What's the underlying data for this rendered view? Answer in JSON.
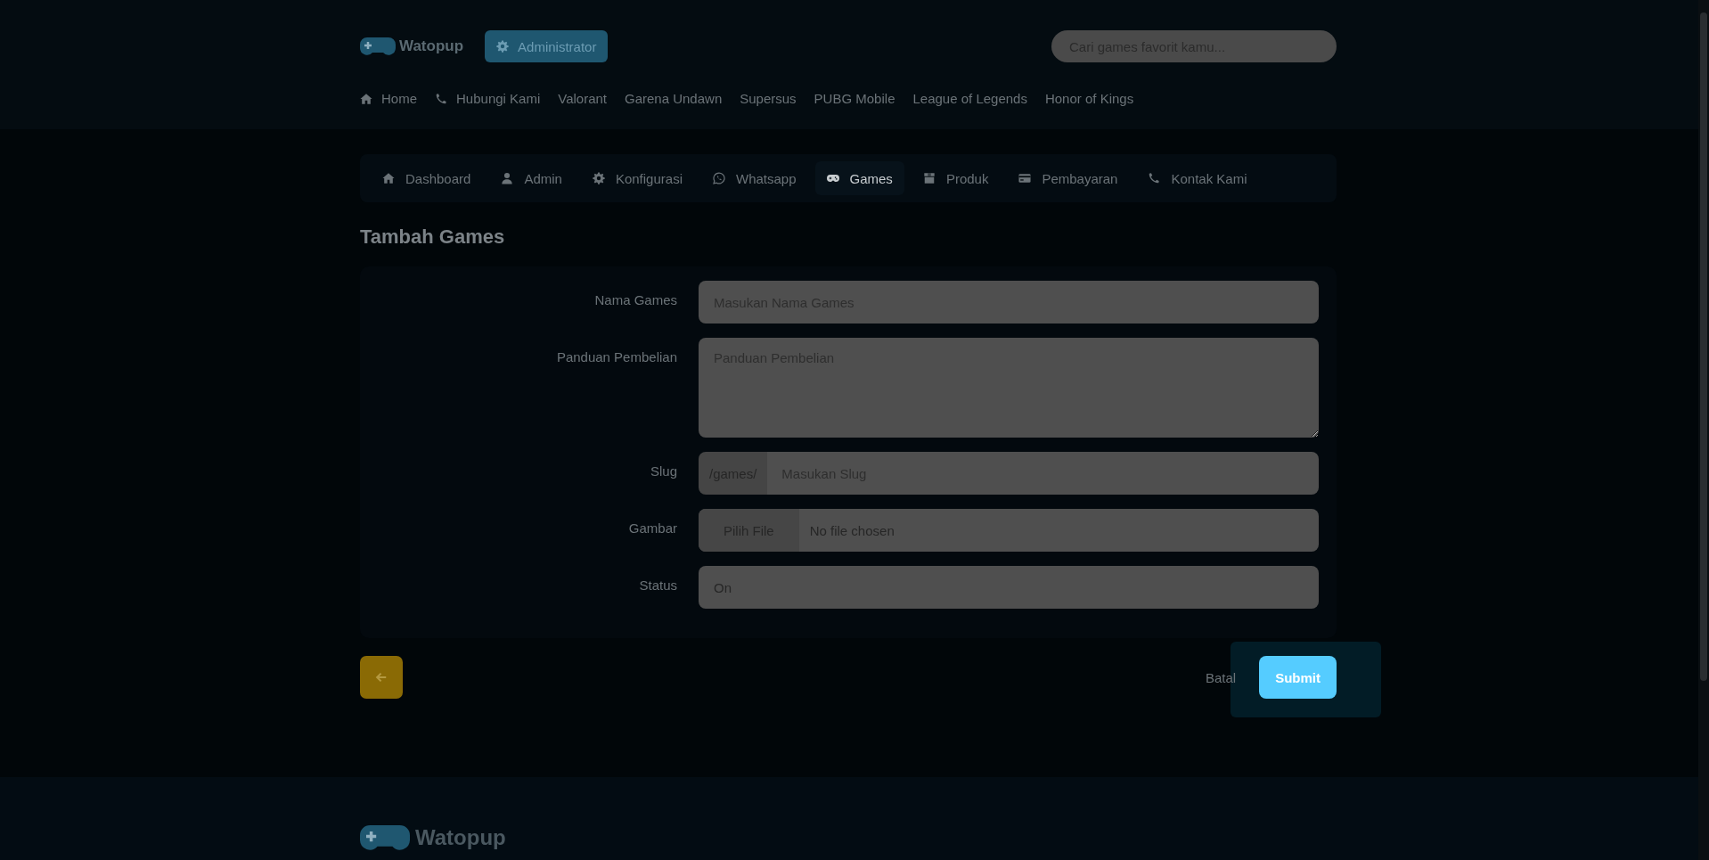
{
  "header": {
    "logo": "Watopup",
    "admin_button": "Administrator",
    "search": {
      "placeholder": "Cari games favorit kamu..."
    },
    "nav": [
      {
        "label": "Home"
      },
      {
        "label": "Hubungi Kami"
      },
      {
        "label": "Valorant"
      },
      {
        "label": "Garena Undawn"
      },
      {
        "label": "Supersus"
      },
      {
        "label": "PUBG Mobile"
      },
      {
        "label": "League of Legends"
      },
      {
        "label": "Honor of Kings"
      }
    ]
  },
  "tabs": [
    {
      "label": "Dashboard",
      "selected": false
    },
    {
      "label": "Admin",
      "selected": false
    },
    {
      "label": "Konfigurasi",
      "selected": false
    },
    {
      "label": "Whatsapp",
      "selected": false
    },
    {
      "label": "Games",
      "selected": true
    },
    {
      "label": "Produk",
      "selected": false
    },
    {
      "label": "Pembayaran",
      "selected": false
    },
    {
      "label": "Kontak Kami",
      "selected": false
    }
  ],
  "page_title": "Tambah Games",
  "form": {
    "fields": [
      {
        "kind": "text",
        "label": "Nama Games",
        "placeholder": "Masukan Nama Games"
      },
      {
        "kind": "textarea",
        "label": "Panduan Pembelian",
        "placeholder": "Panduan Pembelian"
      },
      {
        "kind": "prefixed",
        "label": "Slug",
        "prefix": "/games/",
        "placeholder": "Masukan Slug"
      },
      {
        "kind": "file",
        "label": "Gambar",
        "button": "Pilih File",
        "value": "No file chosen"
      },
      {
        "kind": "value",
        "label": "Status",
        "value": "On"
      }
    ]
  },
  "actions": {
    "cancel": "Batal",
    "submit": "Submit"
  },
  "footer": {
    "logo": "Watopup"
  }
}
